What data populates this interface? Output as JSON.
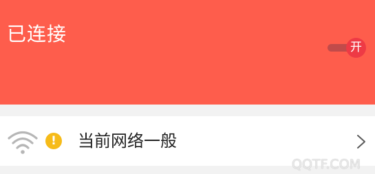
{
  "header": {
    "status_text": "已连接",
    "toggle_label": "开",
    "bg_color": "#fe5d4c"
  },
  "network_row": {
    "wifi_icon": "wifi-icon",
    "warning_icon": "warning-icon",
    "warning_glyph": "!",
    "label": "当前网络一般",
    "chevron_icon": "chevron-right-icon"
  },
  "watermark": {
    "text": "QQTF.COM"
  }
}
